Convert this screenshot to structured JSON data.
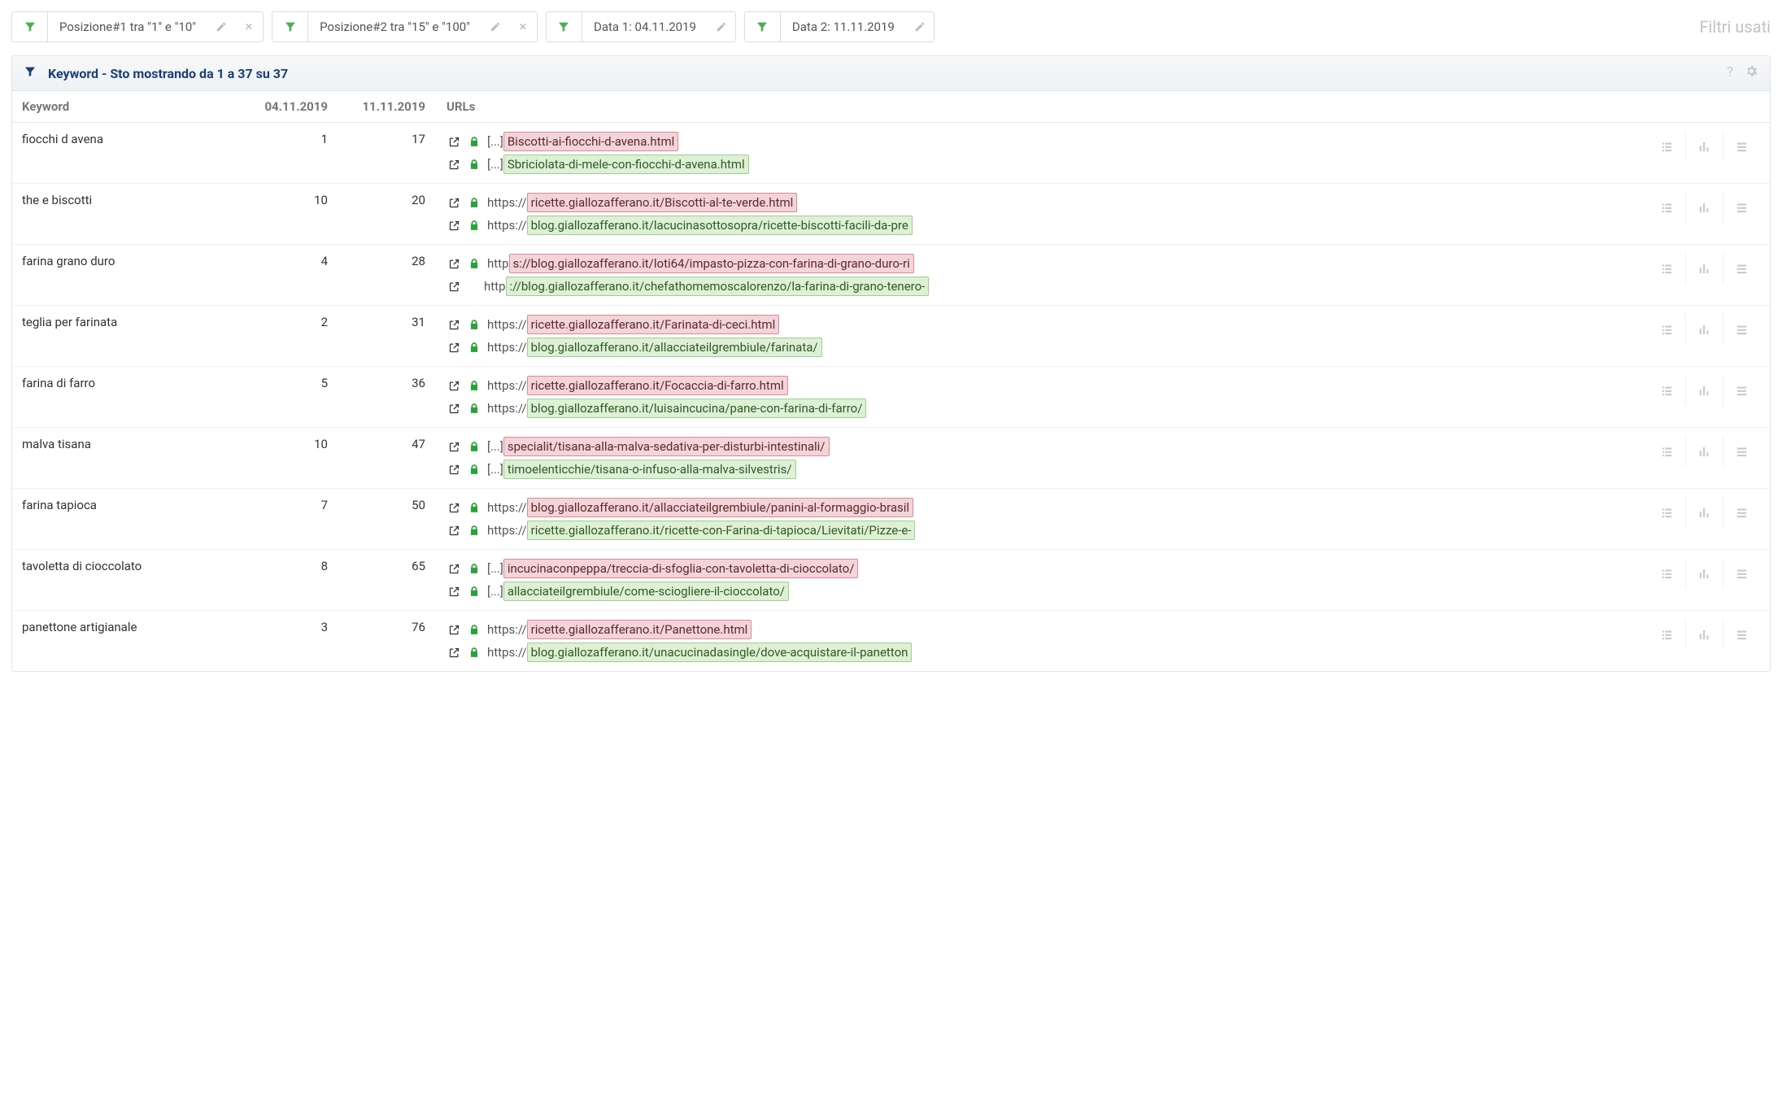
{
  "filters": {
    "usedLabel": "Filtri usati",
    "chips": [
      {
        "label": "Posizione#1 tra \"1\" e \"10\"",
        "editable": true,
        "removable": true
      },
      {
        "label": "Posizione#2 tra \"15\" e \"100\"",
        "editable": true,
        "removable": true
      },
      {
        "label": "Data 1: 04.11.2019",
        "editable": true,
        "removable": false
      },
      {
        "label": "Data 2: 11.11.2019",
        "editable": true,
        "removable": false
      }
    ]
  },
  "panel": {
    "title": "Keyword - Sto mostrando da 1 a 37 su 37"
  },
  "columns": {
    "keyword": "Keyword",
    "date1": "04.11.2019",
    "date2": "11.11.2019",
    "urls": "URLs"
  },
  "rows": [
    {
      "keyword": "fiocchi d avena",
      "pos1": "1",
      "pos2": "17",
      "urls": [
        {
          "https": true,
          "prefix": "[...]",
          "hl": "Biscotti-ai-fiocchi-d-avena.html",
          "tone": "red"
        },
        {
          "https": true,
          "prefix": "[...]",
          "hl": "Sbriciolata-di-mele-con-fiocchi-d-avena.html",
          "tone": "green"
        }
      ]
    },
    {
      "keyword": "the e biscotti",
      "pos1": "10",
      "pos2": "20",
      "urls": [
        {
          "https": true,
          "prefix": "https://",
          "hl": "ricette.giallozafferano.it/Biscotti-al-te-verde.html",
          "tone": "red"
        },
        {
          "https": true,
          "prefix": "https://",
          "hl": "blog.giallozafferano.it/lacucinasottosopra/ricette-biscotti-facili-da-pre",
          "tone": "green"
        }
      ]
    },
    {
      "keyword": "farina grano duro",
      "pos1": "4",
      "pos2": "28",
      "urls": [
        {
          "https": true,
          "prefix": "http",
          "hl": "s://blog.giallozafferano.it/loti64/impasto-pizza-con-farina-di-grano-duro-ri",
          "tone": "red"
        },
        {
          "https": false,
          "prefix": "http",
          "hl": "://blog.giallozafferano.it/chefathomemoscalorenzo/la-farina-di-grano-tenero-",
          "tone": "green"
        }
      ]
    },
    {
      "keyword": "teglia per farinata",
      "pos1": "2",
      "pos2": "31",
      "urls": [
        {
          "https": true,
          "prefix": "https://",
          "hl": "ricette.giallozafferano.it/Farinata-di-ceci.html",
          "tone": "red"
        },
        {
          "https": true,
          "prefix": "https://",
          "hl": "blog.giallozafferano.it/allacciateilgrembiule/farinata/",
          "tone": "green"
        }
      ]
    },
    {
      "keyword": "farina di farro",
      "pos1": "5",
      "pos2": "36",
      "urls": [
        {
          "https": true,
          "prefix": "https://",
          "hl": "ricette.giallozafferano.it/Focaccia-di-farro.html",
          "tone": "red"
        },
        {
          "https": true,
          "prefix": "https://",
          "hl": "blog.giallozafferano.it/luisaincucina/pane-con-farina-di-farro/",
          "tone": "green"
        }
      ]
    },
    {
      "keyword": "malva tisana",
      "pos1": "10",
      "pos2": "47",
      "urls": [
        {
          "https": true,
          "prefix": "[...]",
          "hl": "specialit/tisana-alla-malva-sedativa-per-disturbi-intestinali/",
          "tone": "red"
        },
        {
          "https": true,
          "prefix": "[...]",
          "hl": "timoelenticchie/tisana-o-infuso-alla-malva-silvestris/",
          "tone": "green"
        }
      ]
    },
    {
      "keyword": "farina tapioca",
      "pos1": "7",
      "pos2": "50",
      "urls": [
        {
          "https": true,
          "prefix": "https://",
          "hl": "blog.giallozafferano.it/allacciateilgrembiule/panini-al-formaggio-brasil",
          "tone": "red"
        },
        {
          "https": true,
          "prefix": "https://",
          "hl": "ricette.giallozafferano.it/ricette-con-Farina-di-tapioca/Lievitati/Pizze-e-",
          "tone": "green"
        }
      ]
    },
    {
      "keyword": "tavoletta di cioccolato",
      "pos1": "8",
      "pos2": "65",
      "urls": [
        {
          "https": true,
          "prefix": "[...]",
          "hl": "incucinaconpeppa/treccia-di-sfoglia-con-tavoletta-di-cioccolato/",
          "tone": "red"
        },
        {
          "https": true,
          "prefix": "[...]",
          "hl": "allacciateilgrembiule/come-sciogliere-il-cioccolato/",
          "tone": "green"
        }
      ]
    },
    {
      "keyword": "panettone artigianale",
      "pos1": "3",
      "pos2": "76",
      "urls": [
        {
          "https": true,
          "prefix": "https://",
          "hl": "ricette.giallozafferano.it/Panettone.html",
          "tone": "red"
        },
        {
          "https": true,
          "prefix": "https://",
          "hl": "blog.giallozafferano.it/unacucinadasingle/dove-acquistare-il-panetton",
          "tone": "green"
        }
      ]
    }
  ]
}
